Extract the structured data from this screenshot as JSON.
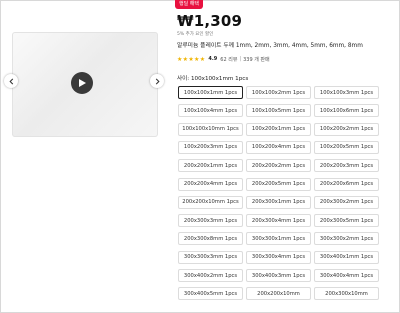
{
  "badge": "행딜 해택",
  "price": "₩1,309",
  "sub_note": "5% 추가 요인 할인",
  "title": "알루미늄 플레이트 두께 1mm, 2mm, 3mm, 4mm, 5mm, 6mm, 8mm",
  "rating": {
    "stars": "★★★★★",
    "score": "4.9",
    "reviews": "62 리뷰",
    "sold": "339 개 판매"
  },
  "option_label": "사이: 100x100x1mm 1pcs",
  "options": [
    "100x100x1mm 1pcs",
    "100x100x2mm 1pcs",
    "100x100x3mm 1pcs",
    "100x100x4mm 1pcs",
    "100x100x5mm 1pcs",
    "100x100x6mm 1pcs",
    "100x100x10mm 1pcs",
    "100x200x1mm 1pcs",
    "100x200x2mm 1pcs",
    "100x200x3mm 1pcs",
    "100x200x4mm 1pcs",
    "100x200x5mm 1pcs",
    "200x200x1mm 1pcs",
    "200x200x2mm 1pcs",
    "200x200x3mm 1pcs",
    "200x200x4mm 1pcs",
    "200x200x5mm 1pcs",
    "200x200x6mm 1pcs",
    "200x200x10mm 1pcs",
    "200x300x1mm 1pcs",
    "200x300x2mm 1pcs",
    "200x300x3mm 1pcs",
    "200x300x4mm 1pcs",
    "200x300x5mm 1pcs",
    "200x300x8mm 1pcs",
    "300x300x1mm 1pcs",
    "300x300x2mm 1pcs",
    "300x300x3mm 1pcs",
    "300x300x4mm 1pcs",
    "300x400x1mm 1pcs",
    "300x400x2mm 1pcs",
    "300x400x3mm 1pcs",
    "300x400x4mm 1pcs",
    "300x400x5mm 1pcs",
    "200x200x10mm",
    "200x300x10mm"
  ],
  "selected_option": "100x100x1mm 1pcs",
  "colors": {
    "accent": "#e8113f",
    "star": "#f0b400"
  },
  "icons": {
    "play": "play-icon",
    "prev": "chevron-left-icon",
    "next": "chevron-right-icon"
  }
}
